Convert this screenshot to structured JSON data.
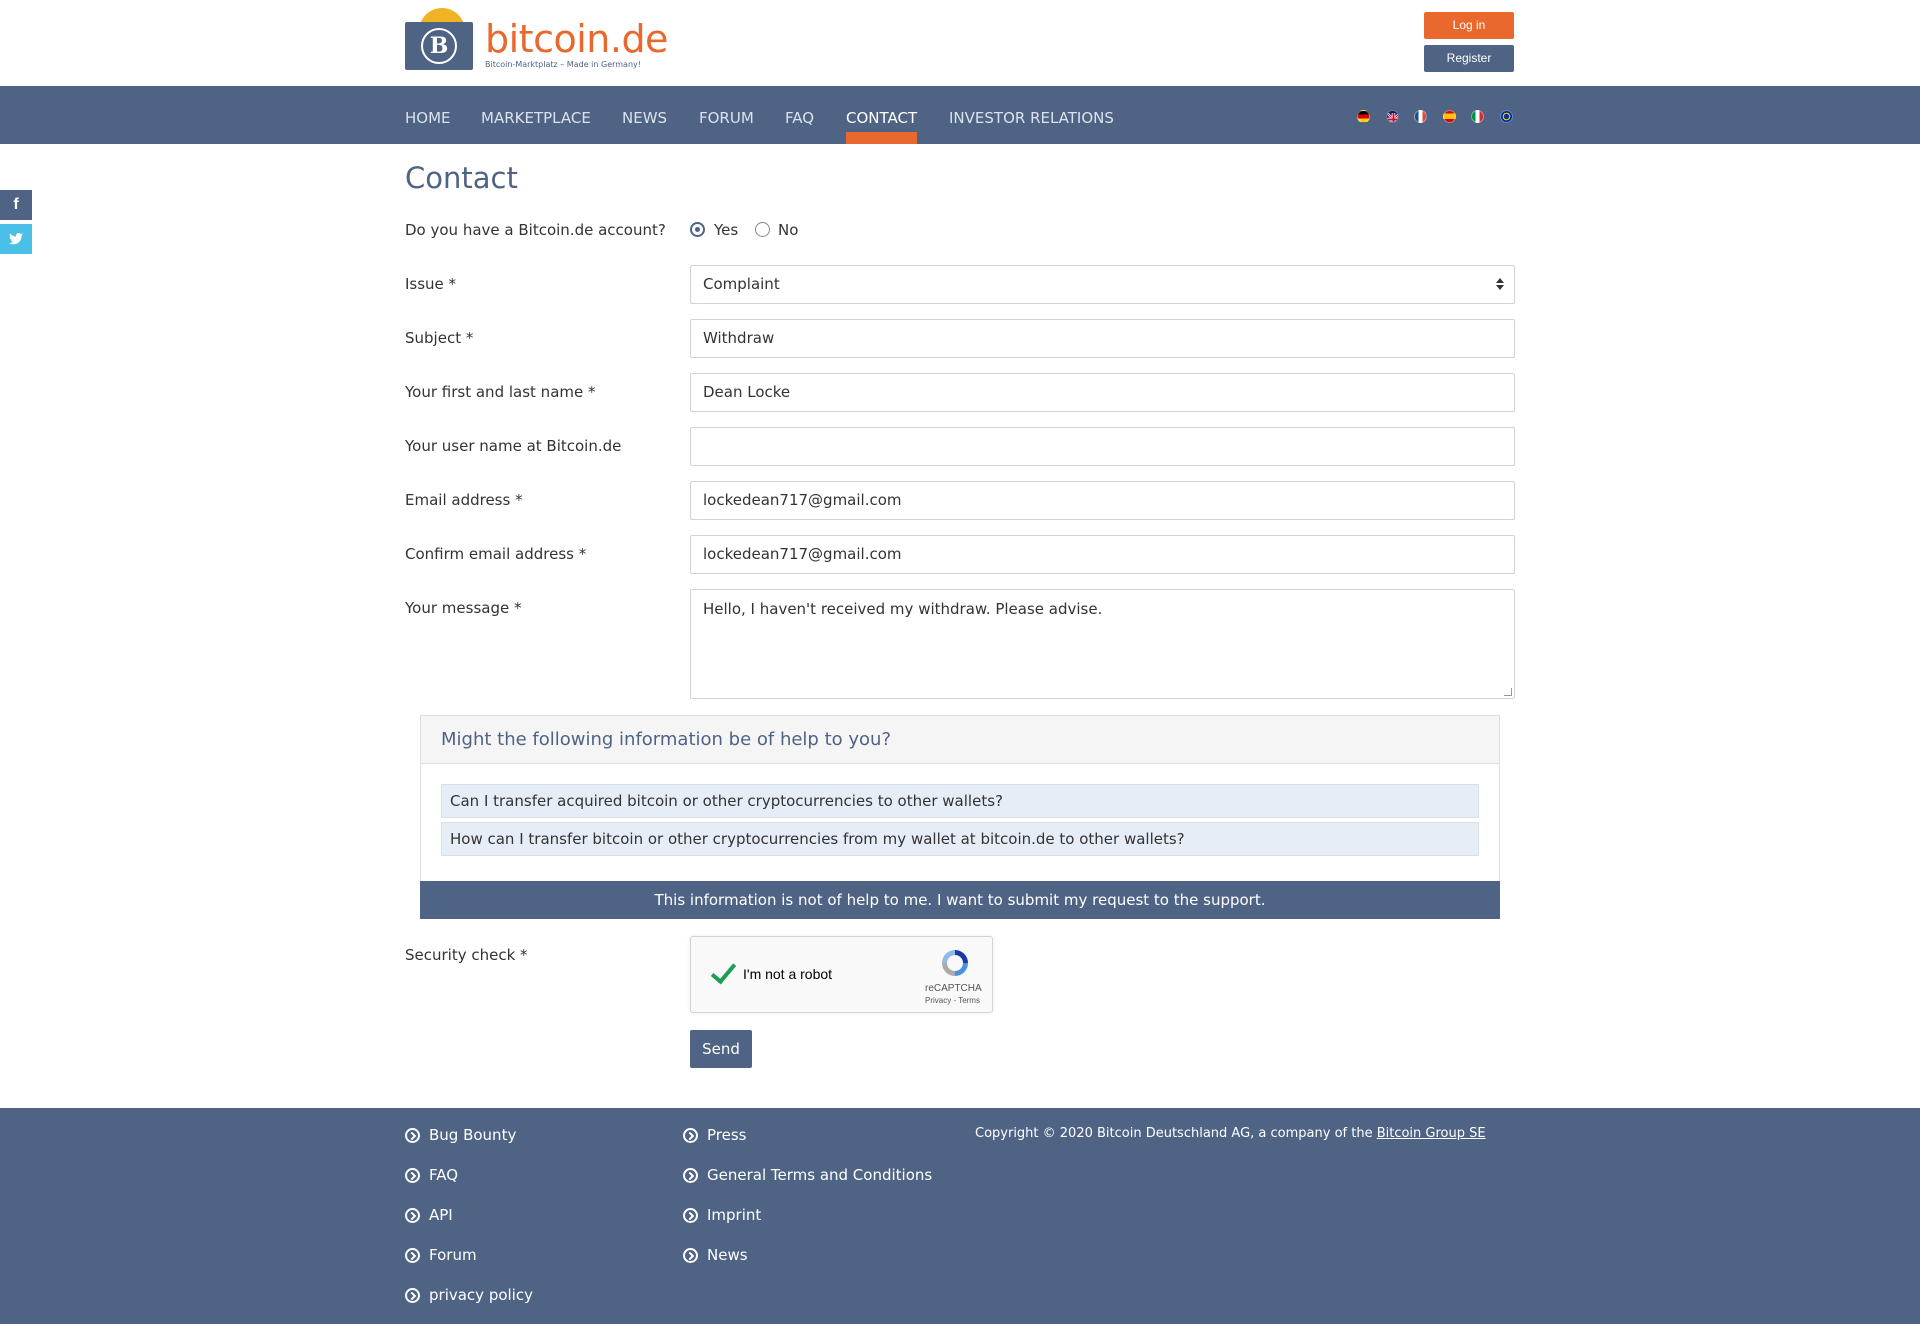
{
  "header": {
    "logo_name": "bitcoin.de",
    "logo_tagline": "Bitcoin-Marktplatz – Made in Germany!",
    "login_label": "Log in",
    "register_label": "Register"
  },
  "nav": {
    "items": [
      {
        "label": "HOME"
      },
      {
        "label": "MARKETPLACE"
      },
      {
        "label": "NEWS"
      },
      {
        "label": "FORUM"
      },
      {
        "label": "FAQ"
      },
      {
        "label": "CONTACT"
      },
      {
        "label": "INVESTOR RELATIONS"
      }
    ],
    "active": "CONTACT",
    "flags": [
      "german-flag-icon",
      "uk-flag-icon",
      "french-flag-icon",
      "spanish-flag-icon",
      "italian-flag-icon",
      "eu-flag-icon"
    ]
  },
  "social": {
    "facebook": "f",
    "twitter": "t"
  },
  "form": {
    "title": "Contact",
    "account_question": "Do you have a Bitcoin.de account?",
    "yes_label": "Yes",
    "no_label": "No",
    "issue_label": "Issue *",
    "issue_value": "Complaint",
    "subject_label": "Subject *",
    "subject_value": "Withdraw",
    "name_label": "Your first and last name *",
    "name_value": "Dean Locke",
    "username_label": "Your user name at Bitcoin.de",
    "username_value": "",
    "email_label": "Email address *",
    "email_value": "lockedean717@gmail.com",
    "confirm_email_label": "Confirm email address *",
    "confirm_email_value": "lockedean717@gmail.com",
    "message_label": "Your message *",
    "message_value": "Hello, I haven't received my withdraw. Please advise.",
    "security_label": "Security check *",
    "send_label": "Send"
  },
  "help": {
    "title": "Might the following information be of help to you?",
    "items": [
      {
        "text": "Can I transfer acquired bitcoin or other cryptocurrencies to other wallets?"
      },
      {
        "text": "How can I transfer bitcoin or other cryptocurrencies from my wallet at bitcoin.de to other wallets?"
      }
    ],
    "submit_label": "This information is not of help to me. I want to submit my request to the support."
  },
  "recaptcha": {
    "label": "I'm not a robot",
    "brand": "reCAPTCHA",
    "terms": "Privacy - Terms"
  },
  "footer": {
    "col1": [
      {
        "label": "Bug Bounty"
      },
      {
        "label": "FAQ"
      },
      {
        "label": "API"
      },
      {
        "label": "Forum"
      },
      {
        "label": "privacy policy"
      }
    ],
    "col2": [
      {
        "label": "Press"
      },
      {
        "label": "General Terms and Conditions"
      },
      {
        "label": "Imprint"
      },
      {
        "label": "News"
      }
    ],
    "copyright_text": "Copyright © 2020 Bitcoin Deutschland AG, a company of the ",
    "copyright_link": "Bitcoin Group SE"
  },
  "colors": {
    "brand_blue": "#4f6385",
    "brand_orange": "#e8682e",
    "sun_yellow": "#f0b323"
  }
}
